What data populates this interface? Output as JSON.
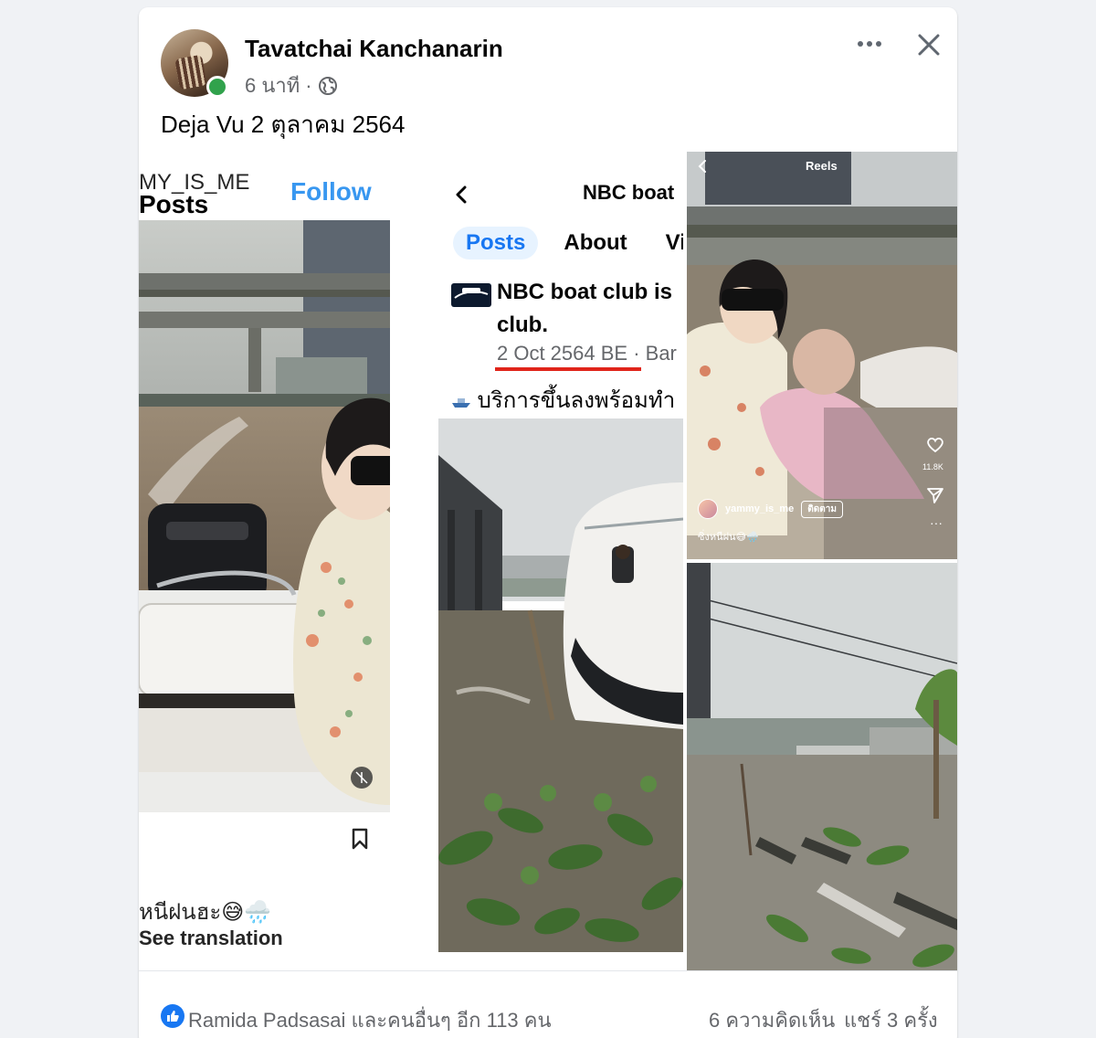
{
  "post": {
    "author": "Tavatchai Kanchanarin",
    "time": "6 นาที",
    "separator": "·",
    "text": "Deja Vu 2 ตุลาคม 2564"
  },
  "panel_instagram": {
    "handle": "MY_IS_ME",
    "posts_label": "Posts",
    "follow_label": "Follow",
    "caption": "หนีฝนฮะ😅🌧️",
    "see_translation": "See translation"
  },
  "panel_facebook_page": {
    "page_name": "NBC boat",
    "tabs": [
      "Posts",
      "About",
      "Vi"
    ],
    "post_title_line1": "NBC boat club is",
    "post_title_line2": "club.",
    "post_date": "2 Oct 2564 BE",
    "post_date_rest": " · Bar",
    "thai_caption": "บริการขึ้นลงพร้อมทำ"
  },
  "panel_reels": {
    "label": "Reels",
    "username": "yammy_is_me",
    "follow_chip": "ติดตาม",
    "caption": "ซิ่งหนีฝน😅🌧️",
    "like_count": "11.8K"
  },
  "footer": {
    "reactions": "Ramida Padsasai และคนอื่นๆ อีก 113 คน",
    "comments": "6 ความคิดเห็น",
    "shares": "แชร์ 3 ครั้ง"
  },
  "colors": {
    "accent": "#1877f2",
    "online": "#31a24c",
    "instagram_follow": "#3897f0",
    "underline": "#e0251b"
  },
  "icons": [
    "more-icon",
    "close-icon",
    "globe-icon",
    "bookmark-icon",
    "back-icon",
    "heart-icon",
    "send-icon",
    "like-icon"
  ]
}
